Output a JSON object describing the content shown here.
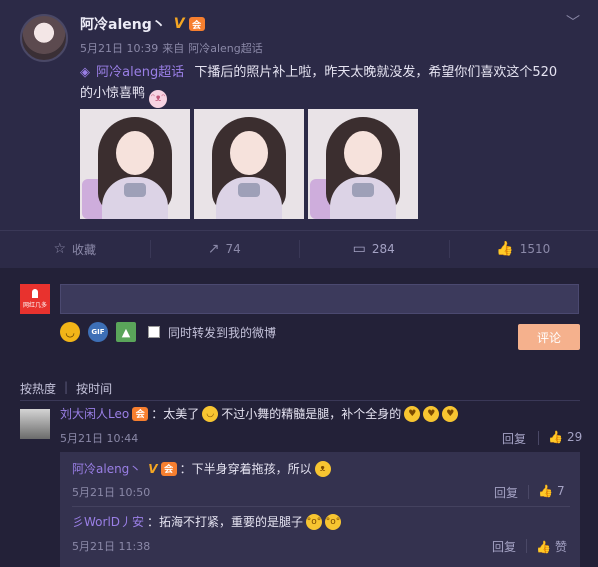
{
  "post": {
    "author": "阿冷aleng丶",
    "verified_mark": "V",
    "level_badge": "会",
    "time": "5月21日 10:39",
    "source_prefix": "来自",
    "source": "阿冷aleng超话",
    "topic_link": "阿冷aleng超话",
    "text": "下播后的照片补上啦，昨天太晚就没发，希望你们喜欢这个520的小惊喜鸭",
    "photos_count": 3
  },
  "actions": {
    "favorite": "收藏",
    "repost": "74",
    "comment": "284",
    "like": "1510"
  },
  "compose": {
    "placeholder": "",
    "forward_label": "同时转发到我的微博",
    "submit": "评论",
    "my_avatar_caption": "网红几多"
  },
  "sort": {
    "hot": "按热度",
    "time": "按时间"
  },
  "comments": [
    {
      "user": "刘大闲人Leo",
      "text_a": "：太美了",
      "text_b": "不过小舞的精髓是腿，补个全身的",
      "time": "5月21日 10:44",
      "reply": "回复",
      "likes": "29"
    }
  ],
  "replies": [
    {
      "user": "阿冷aleng丶",
      "verified_mark": "V",
      "text": "：下半身穿着拖孩，所以",
      "time": "5月21日 10:50",
      "reply": "回复",
      "likes": "7"
    },
    {
      "user": "彡WorlD丿安",
      "text": "：拓海不打紧，重要的是腿子",
      "time": "5月21日 11:38",
      "reply": "回复",
      "likes": "赞"
    }
  ],
  "colors": {
    "background": "#2c2a47",
    "link": "#9a7fe6",
    "submit": "#f5b18d"
  }
}
